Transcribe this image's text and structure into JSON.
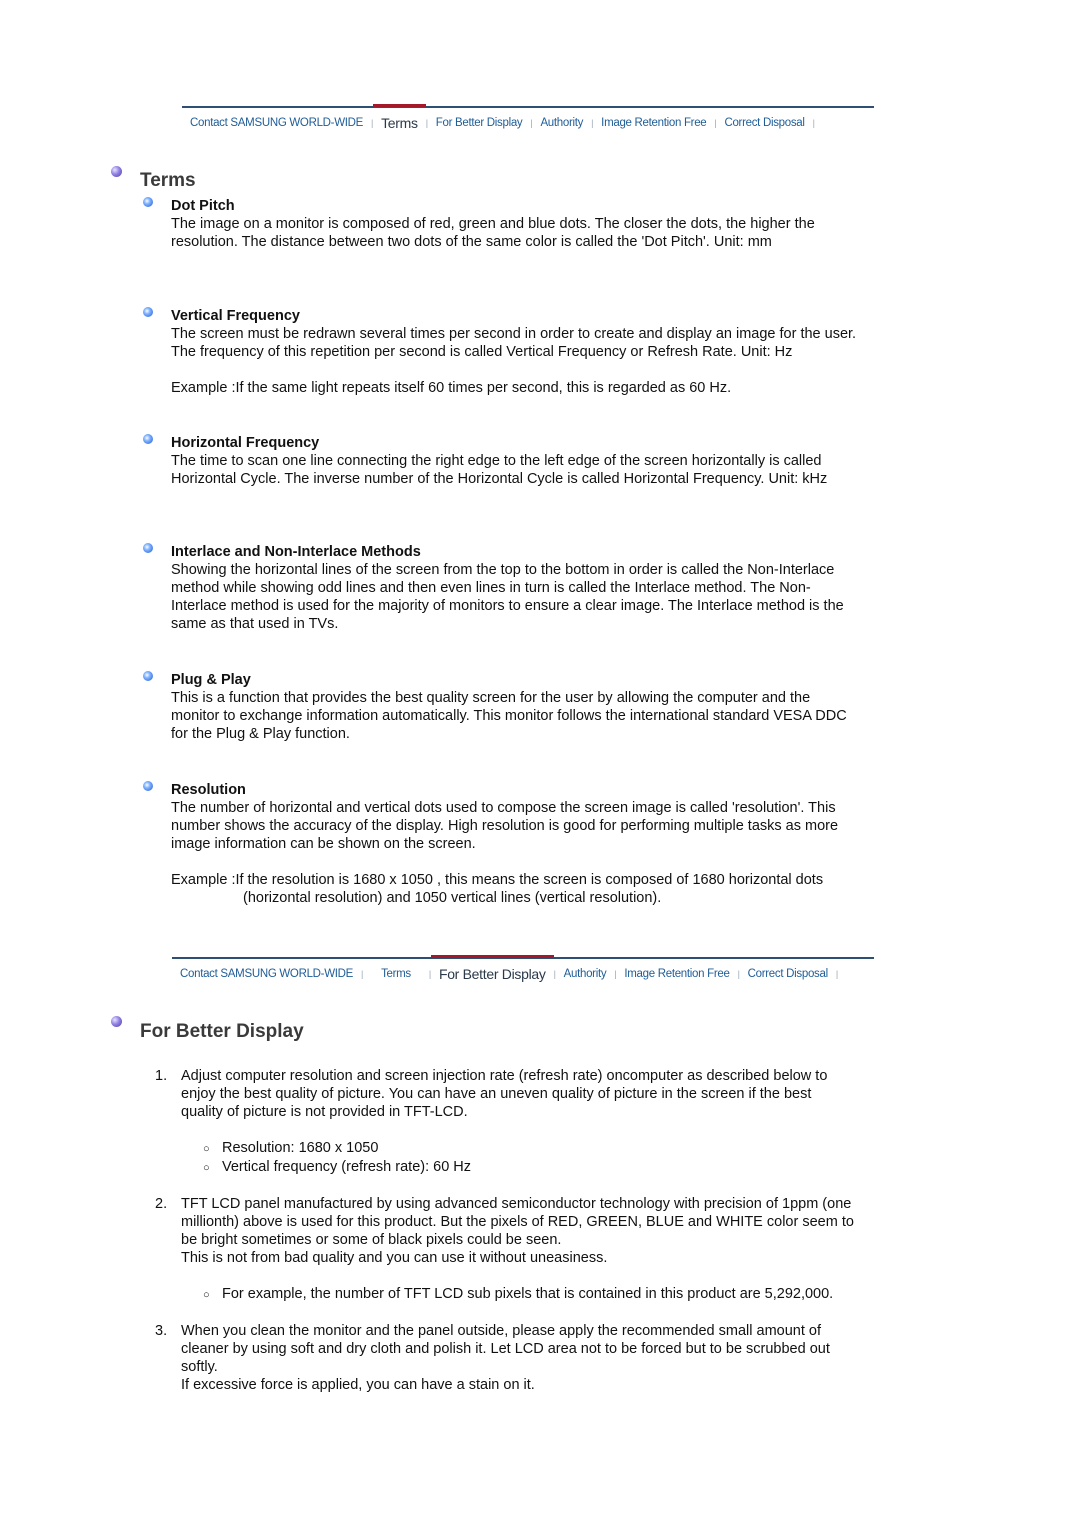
{
  "nav_top": {
    "items": [
      {
        "label": "Contact SAMSUNG WORLD-WIDE",
        "active": false
      },
      {
        "label": "Terms",
        "active": true
      },
      {
        "label": "For Better Display",
        "active": false
      },
      {
        "label": "Authority",
        "active": false
      },
      {
        "label": "Image Retention Free",
        "active": false
      },
      {
        "label": "Correct Disposal",
        "active": false
      }
    ]
  },
  "terms": {
    "title": "Terms",
    "entries": [
      {
        "heading": "Dot Pitch",
        "body": "The image on a monitor is composed of red, green and blue dots. The closer the dots, the higher the resolution. The distance between two dots of the same color is called the 'Dot Pitch'. Unit: mm"
      },
      {
        "heading": "Vertical Frequency",
        "body": "The screen must be redrawn several times per second in order to create and display an image for the user. The frequency of this repetition per second is called Vertical Frequency or Refresh Rate. Unit: Hz",
        "example": "Example :If the same light repeats itself 60 times per second, this is regarded as 60 Hz."
      },
      {
        "heading": "Horizontal Frequency",
        "body": "The time to scan one line connecting the right edge to the left edge of the screen horizontally is called Horizontal Cycle. The inverse number of the Horizontal Cycle is called Horizontal Frequency. Unit: kHz"
      },
      {
        "heading": "Interlace and Non-Interlace Methods",
        "body": "Showing the horizontal lines of the screen from the top to the bottom in order is called the Non-Interlace method while showing odd lines and then even lines in turn is called the Interlace method. The Non-Interlace method is used for the majority of monitors to ensure a clear image. The Interlace method is the same as that used in TVs."
      },
      {
        "heading": "Plug & Play",
        "body": "This is a function that provides the best quality screen for the user by allowing the computer and the monitor to exchange information automatically. This monitor follows the international standard VESA DDC for the Plug & Play function."
      },
      {
        "heading": "Resolution",
        "body": "The number of horizontal and vertical dots used to compose the screen image is called 'resolution'. This number shows the accuracy of the display. High resolution is good for performing multiple tasks as more image information can be shown on the screen.",
        "example": "Example :If the resolution is 1680 x 1050 , this means the screen is composed of 1680 horizontal dots (horizontal resolution) and 1050 vertical lines (vertical resolution)."
      }
    ]
  },
  "nav_bottom": {
    "items": [
      {
        "label": "Contact SAMSUNG WORLD-WIDE",
        "active": false
      },
      {
        "label": "Terms",
        "active": false
      },
      {
        "label": "For Better Display",
        "active": true
      },
      {
        "label": "Authority",
        "active": false
      },
      {
        "label": "Image Retention Free",
        "active": false
      },
      {
        "label": "Correct Disposal",
        "active": false
      }
    ]
  },
  "better_display": {
    "title": "For Better Display",
    "items": [
      {
        "number": "1.",
        "text": "Adjust computer resolution and screen injection rate (refresh rate) oncomputer as described below to enjoy the best quality of picture. You can have an uneven quality of picture in the screen if the best quality of picture is not provided in TFT-LCD.",
        "extra": "",
        "sub": [
          "Resolution: 1680 x 1050",
          "Vertical frequency (refresh rate): 60 Hz"
        ]
      },
      {
        "number": "2.",
        "text": "TFT LCD panel manufactured by using advanced semiconductor technology with precision of 1ppm (one millionth) above is used for this product. But the pixels of RED, GREEN, BLUE and WHITE color seem to be bright sometimes or some of black pixels could be seen.",
        "extra": "This is not from bad quality and you can use it without uneasiness.",
        "sub": [
          "For example, the number of TFT LCD sub pixels that is contained in this product are 5,292,000."
        ]
      },
      {
        "number": "3.",
        "text": "When you clean the monitor and the panel outside, please apply the recommended small amount of cleaner by using soft and dry cloth and polish it. Let LCD area not to be forced but to be scrubbed out softly.",
        "extra": "If excessive force is applied, you can have a stain on it.",
        "sub": []
      }
    ]
  },
  "colors": {
    "nav_link": "#1f5d97",
    "nav_active_bar": "#a3192a",
    "nav_rule": "#2c4f73",
    "section_title": "#3a3a3a"
  }
}
